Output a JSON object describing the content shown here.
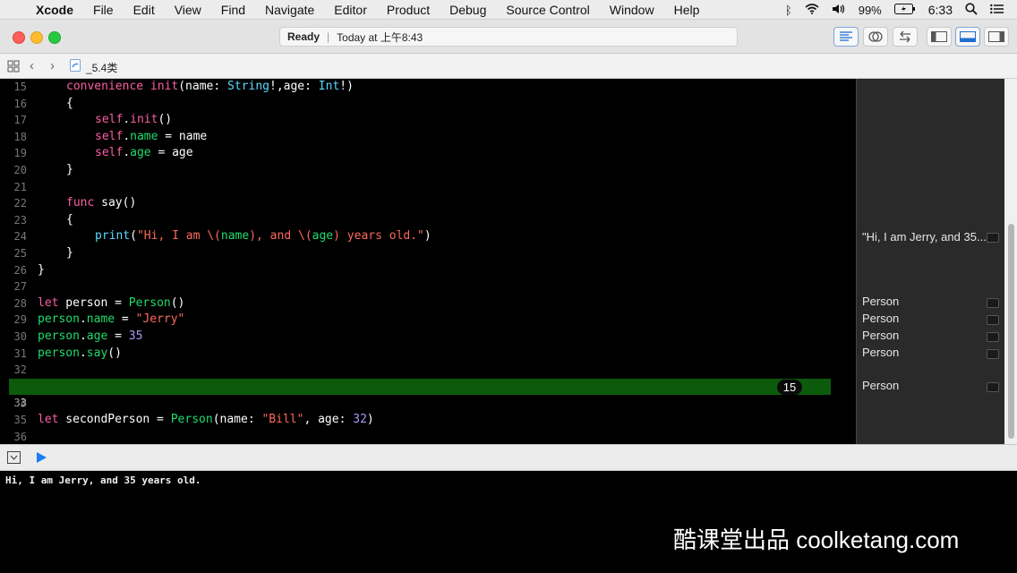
{
  "menubar": {
    "app": "Xcode",
    "items": [
      "File",
      "Edit",
      "View",
      "Find",
      "Navigate",
      "Editor",
      "Product",
      "Debug",
      "Source Control",
      "Window",
      "Help"
    ],
    "battery": "99%",
    "time": "6:33"
  },
  "toolbar": {
    "status_state": "Ready",
    "status_time": "Today at 上午8:43"
  },
  "jumpbar": {
    "file": "_5.4类"
  },
  "editor": {
    "lines": [
      {
        "n": "15"
      },
      {
        "n": "16"
      },
      {
        "n": "17"
      },
      {
        "n": "18"
      },
      {
        "n": "19"
      },
      {
        "n": "20"
      },
      {
        "n": "21"
      },
      {
        "n": "22"
      },
      {
        "n": "23"
      },
      {
        "n": "24"
      },
      {
        "n": "25"
      },
      {
        "n": "26"
      },
      {
        "n": "27"
      },
      {
        "n": "28"
      },
      {
        "n": "29"
      },
      {
        "n": "30"
      },
      {
        "n": "31"
      },
      {
        "n": "32"
      },
      {
        "n": "33"
      },
      {
        "n": "34"
      },
      {
        "n": "35"
      },
      {
        "n": "36"
      }
    ],
    "code": {
      "l15": {
        "a": "convenience",
        "b": "init",
        "c": "(name: ",
        "d": "String",
        "e": "!,age: ",
        "f": "Int",
        "g": "!)"
      },
      "l16": "{",
      "l17": {
        "a": "self",
        "b": ".",
        "c": "init",
        "d": "()"
      },
      "l18": {
        "a": "self",
        "b": ".",
        "c": "name",
        "d": " = name"
      },
      "l19": {
        "a": "self",
        "b": ".",
        "c": "age",
        "d": " = age"
      },
      "l20": "}",
      "l22": {
        "a": "func",
        "b": " say()"
      },
      "l23": "{",
      "l24": {
        "a": "print",
        "b": "(",
        "c": "\"Hi, I am \\(",
        "d": "name",
        "e": "), and \\(",
        "f": "age",
        "g": ") years old.\"",
        "h": ")"
      },
      "l25": "}",
      "l26": "}",
      "l28": {
        "a": "let",
        "b": " person = ",
        "c": "Person",
        "d": "()"
      },
      "l29": {
        "a": "person",
        "b": ".",
        "c": "name",
        "d": " = ",
        "e": "\"Jerry\""
      },
      "l30": {
        "a": "person",
        "b": ".",
        "c": "age",
        "d": " = ",
        "e": "35"
      },
      "l31": {
        "a": "person",
        "b": ".",
        "c": "say",
        "d": "()"
      },
      "l33": {
        "a": "let",
        "b": " secondPerson = ",
        "c": "Person",
        "d": "(name: ",
        "e": "\"Bill\"",
        "f": ", age: ",
        "g": "32",
        "h": ")"
      }
    },
    "inline_badge": "15"
  },
  "results": {
    "l24": "\"Hi, I am Jerry, and 35...",
    "l28": "Person",
    "l29": "Person",
    "l30": "Person",
    "l31": "Person",
    "l33": "Person"
  },
  "console": {
    "output": "Hi, I am Jerry, and 35 years old."
  },
  "watermark": "酷课堂出品 coolketang.com",
  "colors": {
    "highlight_line": "#0c5a0c",
    "keyword": "#fc5fa3",
    "type": "#5dd8ff",
    "string": "#fc6a5d"
  }
}
